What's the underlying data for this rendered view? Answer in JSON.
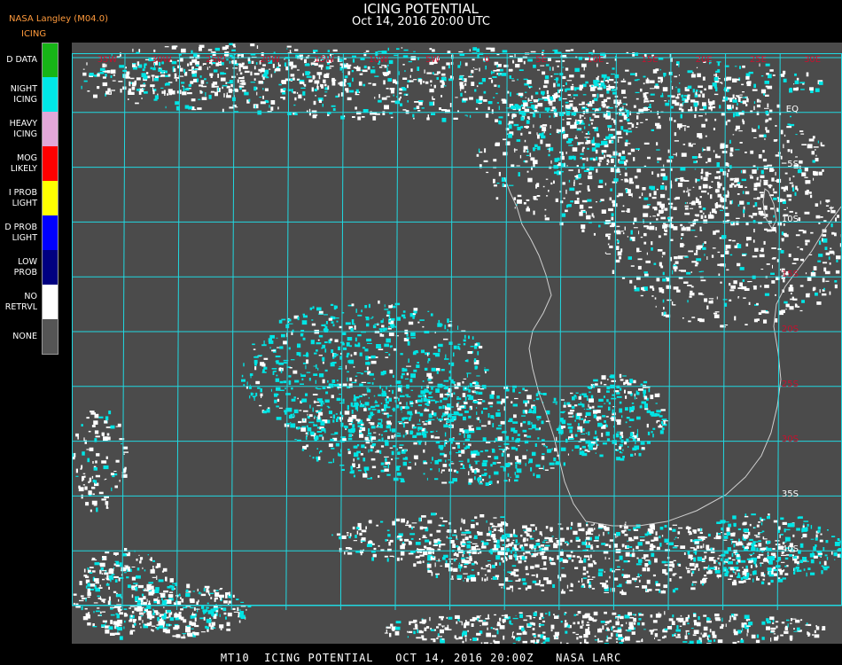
{
  "header": {
    "title": "ICING POTENTIAL",
    "subtitle": "Oct 14, 2016 20:00 UTC",
    "brand": "NASA Langley (M04.0)",
    "legend_title": "ICING"
  },
  "legend": [
    {
      "label": "D DATA",
      "color": "#17b517"
    },
    {
      "label": "NIGHT\nICING",
      "color": "#00e8e8"
    },
    {
      "label": "HEAVY\nICING",
      "color": "#e2a8d8"
    },
    {
      "label": "MOG\nLIKELY",
      "color": "#ff0000"
    },
    {
      "label": "I PROB\nLIGHT",
      "color": "#ffff00"
    },
    {
      "label": "D PROB\nLIGHT",
      "color": "#0000ff"
    },
    {
      "label": "LOW\nPROB",
      "color": "#000080"
    },
    {
      "label": "NO\nRETRVL",
      "color": "#ffffff"
    },
    {
      "label": "NONE",
      "color": "#555555"
    }
  ],
  "map": {
    "lon_labels": [
      "35W",
      "30W",
      "25W",
      "20W",
      "15W",
      "10W",
      "5W",
      "0",
      "5E",
      "10E",
      "15E",
      "20E",
      "25E",
      "30E",
      "35E"
    ],
    "lat_labels": [
      "EQ",
      "5S",
      "10S",
      "15S",
      "20S",
      "25S",
      "30S",
      "35S",
      "40S"
    ],
    "colors": {
      "background": "#4b4b4b",
      "grid": "#20d8e0",
      "label": "#c8102e"
    }
  },
  "footer": {
    "text": "MT10  ICING POTENTIAL   OCT 14, 2016 20:00Z   NASA LARC"
  }
}
